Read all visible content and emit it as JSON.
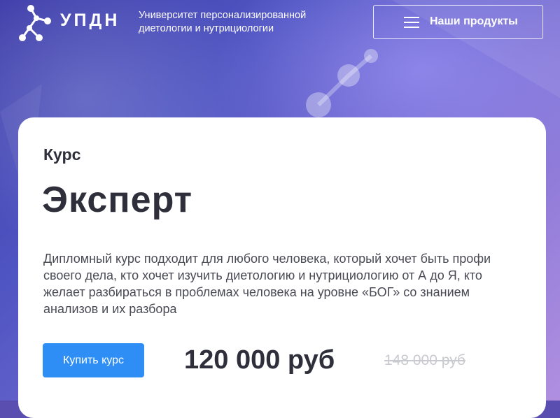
{
  "header": {
    "brand": "УПДН",
    "tagline_line1": "Университет персонализированной",
    "tagline_line2": "диетологии и нутрициологии",
    "products_button_label": "Наши продукты",
    "logo_icon": "molecule-icon",
    "menu_icon": "hamburger-icon"
  },
  "course": {
    "eyebrow": "Курс",
    "title": "Эксперт",
    "description": "Дипломный курс подходит для любого человека, который хочет быть профи своего дела, кто хочет изучить диетологию и нутрициологию от А до Я, кто желает разбираться в проблемах человека на уровне «БОГ» со знанием анализов и их разбора",
    "buy_button_label": "Купить курс",
    "price": "120 000 руб",
    "old_price": "148 000 руб"
  },
  "colors": {
    "accent": "#2f8ef5",
    "text": "#2f2f3b",
    "old_price": "#c9c9d0"
  }
}
